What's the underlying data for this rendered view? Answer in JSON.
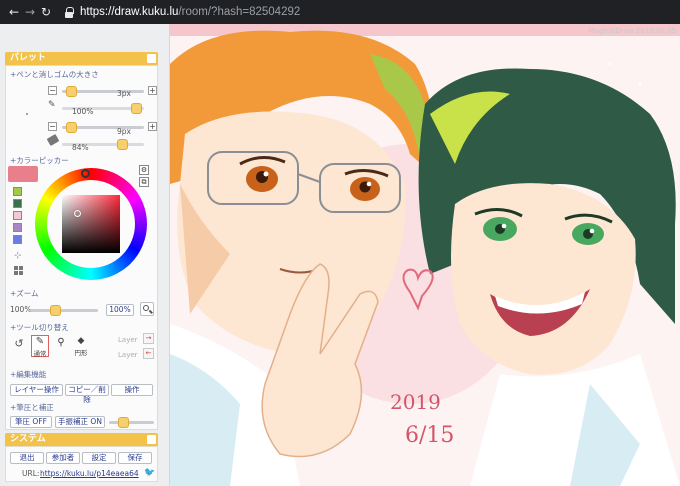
{
  "browser": {
    "url_host": "https://draw.kuku.lu",
    "url_path": "/room/?hash=82504292"
  },
  "palette": {
    "title": "パレット",
    "pen_section": "+ペンと消しゴムの大きさ",
    "pen_size": "3px",
    "pen_opacity": "100%",
    "eraser_size": "9px",
    "eraser_opacity": "84%",
    "color_section": "+カラーピッカー",
    "zoom_section": "+ズーム",
    "zoom_value": "100%",
    "zoom_percent": "100%",
    "tool_section": "+ツール切り替え",
    "tool_normal": "通常",
    "tool_circle": "円形",
    "layer_label_1": "Layer",
    "layer_label_2": "Layer",
    "edit_section": "+編集機能",
    "btn_layer": "レイヤー操作",
    "btn_copy": "コピー／削除",
    "btn_operate": "操作",
    "stroke_section": "+筆圧と補正",
    "btn_pressure_off": "筆圧 OFF",
    "btn_correction_on": "手振補正 ON"
  },
  "system": {
    "title": "システム",
    "btn_exit": "退出",
    "btn_members": "参加者",
    "btn_settings": "設定",
    "btn_save": "保存",
    "url_label": "URL:",
    "url_value": "https://kuku.lu/p14eaea64"
  },
  "canvas": {
    "credit": "MagicalDraw 2019.06.05",
    "sign_year": "2019",
    "sign_date": "6/15"
  },
  "colors": {
    "accent": "#f2c24b",
    "link": "#2a3c8f",
    "swatches": [
      "#e87f8a",
      "#a4c84a",
      "#3b6f4e",
      "#f3c9d6",
      "#a886c9",
      "#6a7ce0"
    ],
    "current": "#e87f8a",
    "picked": "#f3c9d6"
  },
  "icons": [
    "back-arrow-icon",
    "forward-arrow-icon",
    "reload-icon",
    "lock-icon",
    "pen-icon",
    "eraser-icon",
    "magnifier-icon",
    "twitter-icon"
  ]
}
